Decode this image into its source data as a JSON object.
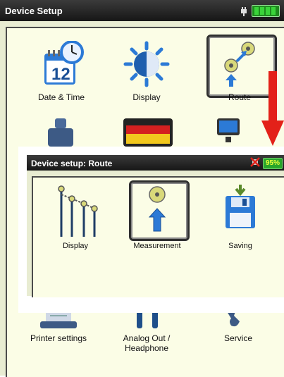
{
  "background_screen": {
    "title": "Device Setup",
    "tiles": [
      {
        "label": "Date & Time",
        "icon": "calendar-clock-icon"
      },
      {
        "label": "Display",
        "icon": "brightness-icon"
      },
      {
        "label": "Route",
        "icon": "route-icon"
      },
      {
        "label": "Printer settings",
        "icon": "printer-icon"
      },
      {
        "label": "Analog Out /\nHeadphone",
        "icon": "analog-out-icon"
      },
      {
        "label": "Service",
        "icon": "wrench-icon"
      }
    ],
    "calendar_day": "12"
  },
  "dialog": {
    "title": "Device setup: Route",
    "battery": "95%",
    "tiles": [
      {
        "label": "Display",
        "icon": "route-display-icon"
      },
      {
        "label": "Measurement",
        "icon": "measurement-icon"
      },
      {
        "label": "Saving",
        "icon": "save-icon"
      }
    ]
  },
  "colors": {
    "panel": "#fbfde6",
    "titlebar": "#1e1e1e",
    "accent_arrow": "#e32119",
    "battery": "#2aa52a"
  }
}
